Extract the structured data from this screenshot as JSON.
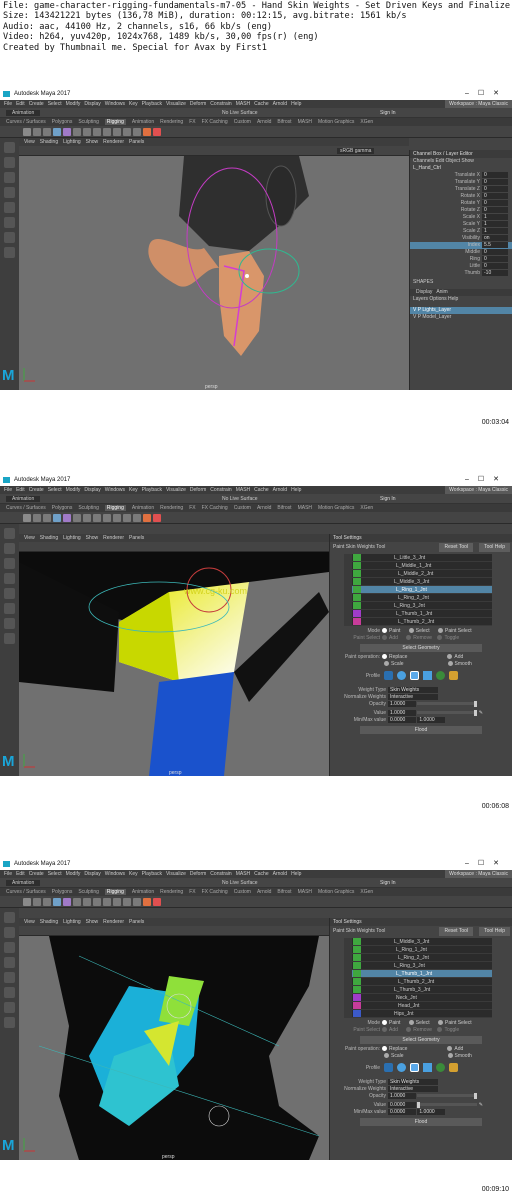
{
  "header": {
    "file": "File: game-character-rigging-fundamentals-m7-05 - Hand Skin Weights - Set Driven Keys and Finalize Scene.mp4",
    "size": "Size: 143421221 bytes (136,78 MiB), duration: 00:12:15, avg.bitrate: 1561 kb/s",
    "audio": "Audio: aac, 44100 Hz, 2 channels, s16, 66 kb/s (eng)",
    "video": "Video: h264, yuv420p, 1024x768, 1489 kb/s, 30,00 fps(r) (eng)",
    "credit": "Created by Thumbnail me. Special for Avax by First1"
  },
  "common": {
    "app_title": "Autodesk Maya 2017",
    "window_controls": "–☐✕",
    "menus": [
      "File",
      "Edit",
      "Create",
      "Select",
      "Modify",
      "Display",
      "Windows",
      "Key",
      "Playback",
      "Visualize",
      "Deform",
      "Constrain",
      "MASH",
      "Cache",
      "Arnold",
      "Help"
    ],
    "workspace_label": "Workspace :",
    "workspace_value": "Maya Classic",
    "mode": "Animation",
    "live_surface": "No Live Surface",
    "sign_in": "Sign In",
    "shelf_tabs": [
      "Curves / Surfaces",
      "Polygons",
      "Sculpting",
      "Rigging",
      "Animation",
      "Rendering",
      "FX",
      "FX Caching",
      "Custom",
      "Arnold",
      "Bifrost",
      "MASH",
      "Motion Graphics",
      "XGen"
    ],
    "active_shelf": "Rigging",
    "viewport_menus": [
      "View",
      "Shading",
      "Lighting",
      "Show",
      "Renderer",
      "Panels"
    ],
    "camera": "persp",
    "maya_logo": "M",
    "accent": "#5285a6",
    "joint_green": "#3fa73f"
  },
  "frame1": {
    "timestamp": "00:03:04",
    "color_space": "sRGB gamma",
    "channel_box": {
      "title": "Channel Box / Layer Editor",
      "menus": [
        "Channels",
        "Edit",
        "Object",
        "Show"
      ],
      "object": "L_Hand_Ctrl",
      "channels": [
        {
          "name": "Translate X",
          "value": "0"
        },
        {
          "name": "Translate Y",
          "value": "0"
        },
        {
          "name": "Translate Z",
          "value": "0"
        },
        {
          "name": "Rotate X",
          "value": "0"
        },
        {
          "name": "Rotate Y",
          "value": "0"
        },
        {
          "name": "Rotate Z",
          "value": "0"
        },
        {
          "name": "Scale X",
          "value": "1"
        },
        {
          "name": "Scale Y",
          "value": "1"
        },
        {
          "name": "Scale Z",
          "value": "1"
        },
        {
          "name": "Visibility",
          "value": "on"
        },
        {
          "name": "Index",
          "value": "5.5"
        },
        {
          "name": "Middle",
          "value": "0"
        },
        {
          "name": "Ring",
          "value": "0"
        },
        {
          "name": "Little",
          "value": "0"
        },
        {
          "name": "Thumb",
          "value": "-10"
        }
      ],
      "selected_channel": "Index",
      "shapes_label": "SHAPES",
      "layer_tabs": [
        "Display",
        "Anim"
      ],
      "layer_menus": [
        "Layers",
        "Options",
        "Help"
      ],
      "layers": [
        {
          "flags": "V  P",
          "name": "Lights_Layer",
          "selected": true
        },
        {
          "flags": "V  P",
          "name": "Model_Layer",
          "selected": false
        }
      ]
    }
  },
  "frame2": {
    "timestamp": "00:06:08",
    "watermark": "www.cg-ku.com",
    "tool": {
      "title": "Tool Settings",
      "name": "Paint Skin Weights Tool",
      "reset": "Reset Tool",
      "help": "Tool Help",
      "influences": [
        "L_Little_3_Jnt",
        "L_Middle_1_Jnt",
        "L_Middle_2_Jnt",
        "L_Middle_3_Jnt",
        "L_Ring_1_Jnt",
        "L_Ring_2_Jnt",
        "L_Ring_3_Jnt",
        "L_Thumb_1_Jnt",
        "L_Thumb_2_Jnt"
      ],
      "selected_influence": "L_Ring_1_Jnt",
      "mode_label": "Mode",
      "modes": [
        "Paint",
        "Select",
        "Paint Select"
      ],
      "paint_select_label": "Paint Select",
      "paint_select_opts": [
        "Add",
        "Remove",
        "Toggle"
      ],
      "select_geometry": "Select Geometry",
      "paint_operation_label": "Paint operation:",
      "paint_ops": [
        "Replace",
        "Add",
        "Scale",
        "Smooth"
      ],
      "profile_label": "Profile",
      "weight_type_label": "Weight Type",
      "weight_type": "Skin Weights",
      "normalize_label": "Normalize Weights",
      "normalize": "Interactive",
      "opacity_label": "Opacity",
      "opacity": "1.0000",
      "value_label": "Value",
      "value": "1.0000",
      "minmax_label": "Min/Max value",
      "min": "0.0000",
      "max": "1.0000",
      "flood": "Flood"
    }
  },
  "frame3": {
    "timestamp": "00:09:10",
    "tool": {
      "title": "Tool Settings",
      "name": "Paint Skin Weights Tool",
      "reset": "Reset Tool",
      "help": "Tool Help",
      "influences": [
        "L_Middle_3_Jnt",
        "L_Ring_1_Jnt",
        "L_Ring_2_Jnt",
        "L_Ring_3_Jnt",
        "L_Thumb_1_Jnt",
        "L_Thumb_2_Jnt",
        "L_Thumb_3_Jnt",
        "Neck_Jnt",
        "Head_Jnt",
        "Hips_Jnt"
      ],
      "selected_influence": "L_Thumb_1_Jnt",
      "mode_label": "Mode",
      "modes": [
        "Paint",
        "Select",
        "Paint Select"
      ],
      "paint_select_label": "Paint Select",
      "paint_select_opts": [
        "Add",
        "Remove",
        "Toggle"
      ],
      "select_geometry": "Select Geometry",
      "paint_operation_label": "Paint operation:",
      "paint_ops": [
        "Replace",
        "Add",
        "Scale",
        "Smooth"
      ],
      "profile_label": "Profile",
      "weight_type_label": "Weight Type",
      "weight_type": "Skin Weights",
      "normalize_label": "Normalize Weights",
      "normalize": "Interactive",
      "opacity_label": "Opacity",
      "opacity": "1.0000",
      "value_label": "Value",
      "value": "0.0000",
      "minmax_label": "Min/Max value",
      "min": "0.0000",
      "max": "1.0000",
      "flood": "Flood"
    }
  }
}
